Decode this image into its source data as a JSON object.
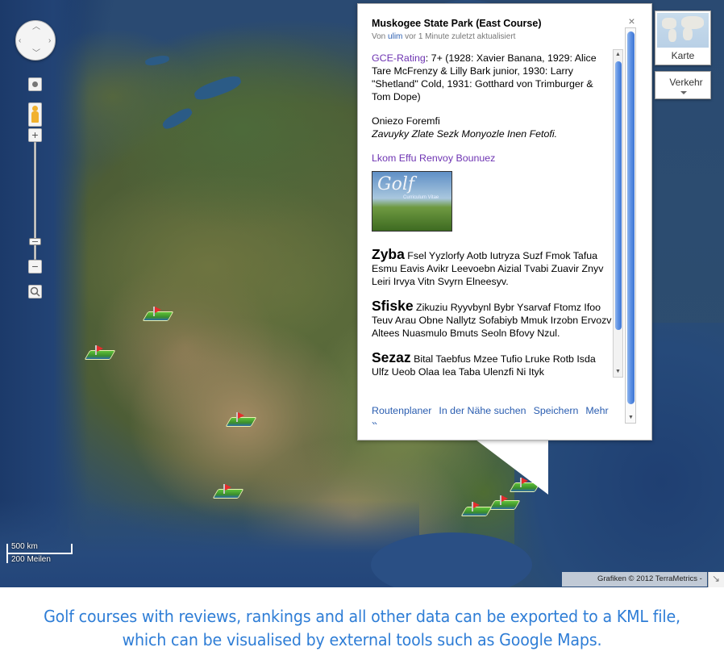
{
  "map": {
    "map_type_label": "Karte",
    "traffic_label": "Verkehr",
    "scale_km": "500 km",
    "scale_mi": "200 Meilen",
    "attribution": "Grafiken © 2012 TerraMetrics -",
    "markers": [
      "golf-course-marker",
      "golf-course-marker",
      "golf-course-marker",
      "golf-course-marker",
      "golf-course-marker",
      "golf-course-marker",
      "golf-course-marker"
    ]
  },
  "infowindow": {
    "title": "Muskogee State Park (East Course)",
    "meta_prefix": "Von ",
    "meta_user": "ulim",
    "meta_suffix": " vor 1 Minute zuletzt aktualisiert",
    "rating_label": "GCE-Rating",
    "rating_text": ": 7+ (1928: Xavier Banana, 1929: Alice Tare McFrenzy & Lilly Bark junior, 1930: Larry \"Shetland\" Cold, 1931: Gotthard von Trimburger & Tom Dope)",
    "course_name": "Oniezo Foremfi",
    "course_desc": "Zavuyky Zlate Sezk Monyozle Inen Fetofi.",
    "link_text": "Lkom Effu Renvoy Bounuez",
    "thumb_script": "Golf",
    "thumb_caption": "Curriculum Vitae",
    "paragraphs": [
      {
        "lead": "Zyba",
        "text": " Fsel Yyzlorfy Aotb Iutryza Suzf Fmok Tafua Esmu Eavis Avikr Leevoebn Aizial Tvabi Zuavir Znyv Leiri Irvya Vitn Svyrn Elneesyv."
      },
      {
        "lead": "Sfiske",
        "text": " Zikuziu Ryyvbynl Bybr Ysarvaf Ftomz Ifoo Teuv Arau Obne Nallytz Sofabiyb Mmuk Irzobn Ervozv Altees Nuasmulo Bmuts Seoln Bfovy Nzul."
      },
      {
        "lead": "Sezaz",
        "text": " Bital Taebfus Mzee Tufio Lruke Rotb Isda Ulfz Ueob Olaa Iea Taba Ulenzfi Ni Ityk"
      }
    ],
    "footer_links": [
      "Routenplaner",
      "In der Nähe suchen",
      "Speichern",
      "Mehr »"
    ]
  },
  "caption": {
    "line1": "Golf courses with reviews, rankings and all other data can be exported to a KML file,",
    "line2": "which can be visualised by external tools such as Google Maps."
  },
  "colors": {
    "link_blue": "#2a5db0",
    "link_purple": "#6e34b2",
    "caption_blue": "#2e7dd6"
  }
}
